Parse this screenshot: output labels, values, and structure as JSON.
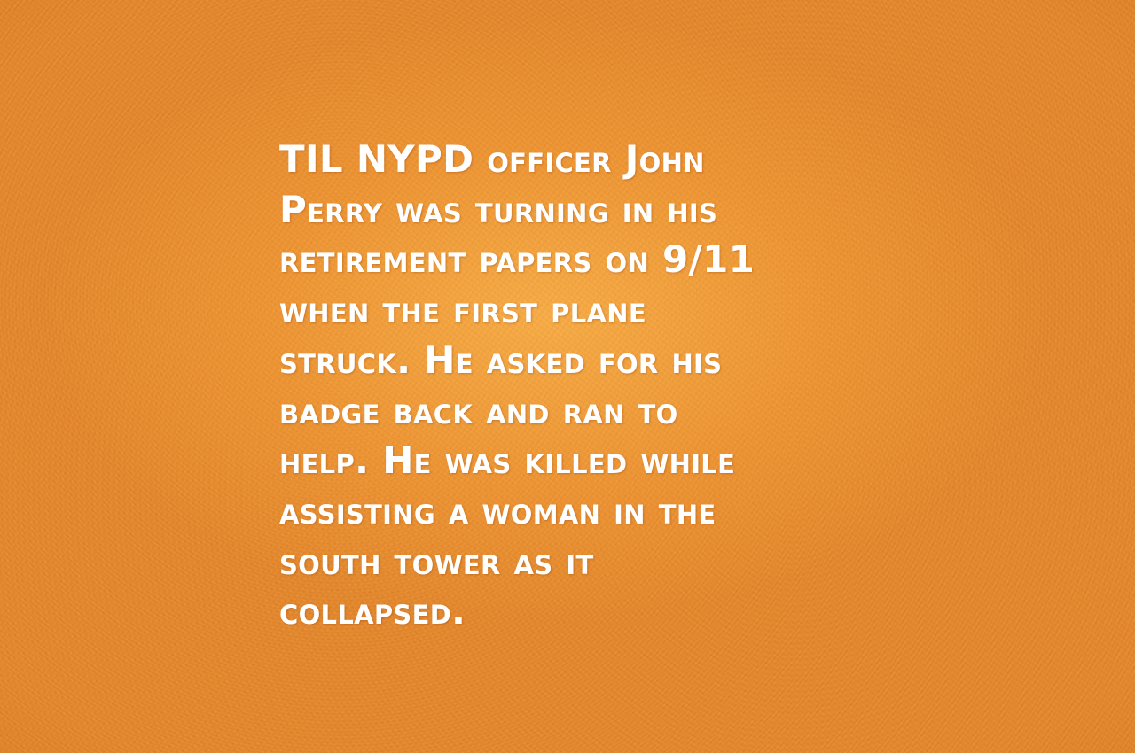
{
  "quote": {
    "lines": [
      "TIL NYPD officer John",
      "Perry was turning in his",
      "retirement papers on 9/11",
      "when the first plane",
      "struck. He asked for his",
      "badge back and ran to",
      "help. He was killed while",
      "assisting a woman in the",
      "south tower as it",
      "collapsed."
    ]
  },
  "colors": {
    "background": "#e98a2c",
    "text": "#ffffff"
  }
}
